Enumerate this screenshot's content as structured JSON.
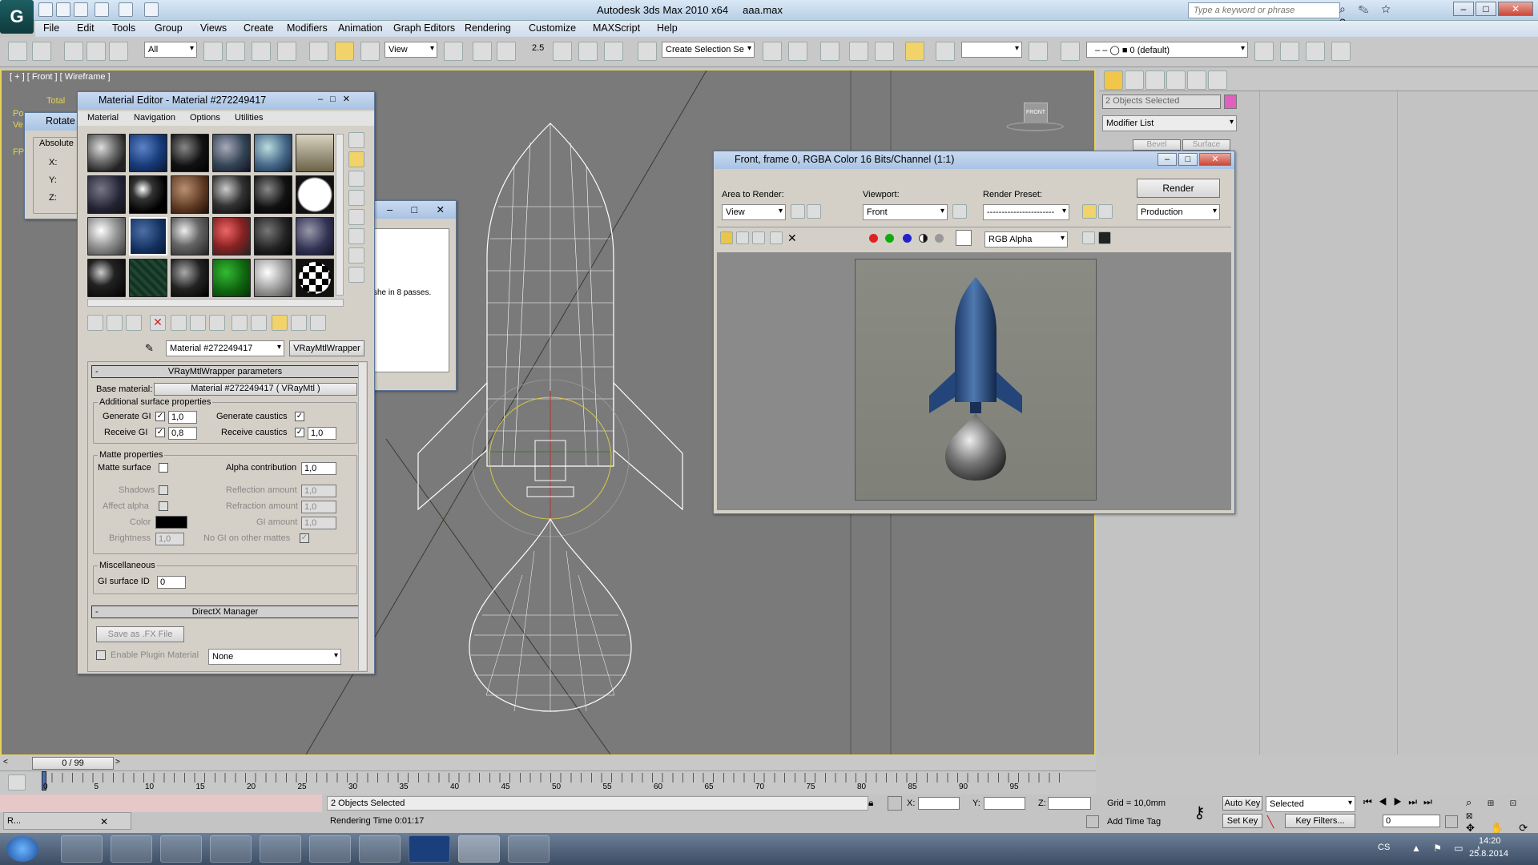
{
  "app": {
    "title": "Autodesk 3ds Max  2010 x64",
    "file": "aaa.max",
    "logo": "G",
    "search_placeholder": "Type a keyword or phrase"
  },
  "menu": [
    "File",
    "Edit",
    "Tools",
    "Group",
    "Views",
    "Create",
    "Modifiers",
    "Animation",
    "Graph Editors",
    "Rendering",
    "Customize",
    "MAXScript",
    "Help"
  ],
  "toolbar": {
    "selection_filter": "All",
    "ref_coord": "View",
    "named_selection": "Create Selection Se",
    "snap_value": "2.5",
    "layer": "0 (default)"
  },
  "viewport": {
    "label": "[ + ] [ Front ] [ Wireframe ]",
    "stat_total": "Total",
    "stat_po": "Po",
    "stat_ve": "Ve",
    "stat_fp": "FP",
    "viewcube": "FRONT"
  },
  "rotate_dialog": {
    "title": "Rotate",
    "group": "Absolute",
    "x": "X:",
    "y": "Y:",
    "z": "Z:"
  },
  "material_editor": {
    "title": "Material Editor - Material #272249417",
    "menus": [
      "Material",
      "Navigation",
      "Options",
      "Utilities"
    ],
    "material_name": "Material #272249417",
    "material_type": "VRayMtlWrapper",
    "rollout_params": "VRayMtlWrapper parameters",
    "base_material_label": "Base material:",
    "base_material_value": "Material #272249417  ( VRayMtl )",
    "additional_group": "Additional surface properties",
    "gen_gi_label": "Generate GI",
    "gen_gi_value": "1,0",
    "gen_caustics_label": "Generate caustics",
    "recv_gi_label": "Receive GI",
    "recv_gi_value": "0,8",
    "recv_caustics_label": "Receive caustics",
    "recv_caustics_value": "1,0",
    "matte_group": "Matte properties",
    "matte_surface": "Matte surface",
    "alpha_contrib_label": "Alpha contribution",
    "alpha_contrib_value": "1,0",
    "shadows": "Shadows",
    "refl_amount": "Reflection amount",
    "refl_value": "1,0",
    "affect_alpha": "Affect alpha",
    "refr_amount": "Refraction amount",
    "refr_value": "1,0",
    "color_label": "Color",
    "gi_amount": "GI amount",
    "gi_amount_value": "1,0",
    "brightness_label": "Brightness",
    "brightness_value": "1,0",
    "no_gi_label": "No GI on other mattes",
    "misc_group": "Miscellaneous",
    "gi_surface_label": "GI surface ID",
    "gi_surface_value": "0",
    "directx_head": "DirectX Manager",
    "save_fx": "Save as .FX File",
    "enable_plugin": "Enable Plugin Material",
    "plugin_value": "None"
  },
  "hidden_dialog": {
    "text": "she in 8 passes."
  },
  "render_window": {
    "title": "Front, frame 0, RGBA Color 16 Bits/Channel (1:1)",
    "area_label": "Area to Render:",
    "area_value": "View",
    "viewport_label": "Viewport:",
    "viewport_value": "Front",
    "preset_label": "Render Preset:",
    "preset_value": "-----------------------",
    "render_button": "Render",
    "production_value": "Production",
    "channel_value": "RGB Alpha"
  },
  "command_panel": {
    "selection": "2 Objects Selected",
    "modifier_list": "Modifier List",
    "tab_bevel": "Bevel",
    "tab_surface": "Surface",
    "accent": "#e060c0"
  },
  "timeline": {
    "frame": "0 / 99",
    "ticks": [
      "0",
      "5",
      "10",
      "15",
      "20",
      "25",
      "30",
      "35",
      "40",
      "45",
      "50",
      "55",
      "60",
      "65",
      "70",
      "75",
      "80",
      "85",
      "90",
      "95"
    ]
  },
  "status": {
    "selected": "2 Objects Selected",
    "render_time": "Rendering Time  0:01:17",
    "x_label": "X:",
    "y_label": "Y:",
    "z_label": "Z:",
    "grid": "Grid = 10,0mm",
    "add_time_tag": "Add Time Tag",
    "auto_key": "Auto Key",
    "set_key": "Set Key",
    "key_mode": "Selected",
    "key_filters": "Key Filters...",
    "frame_field": "0",
    "script_label": "R..."
  },
  "taskbar": {
    "lang": "CS",
    "time": "14:20",
    "date": "25.8.2014"
  }
}
